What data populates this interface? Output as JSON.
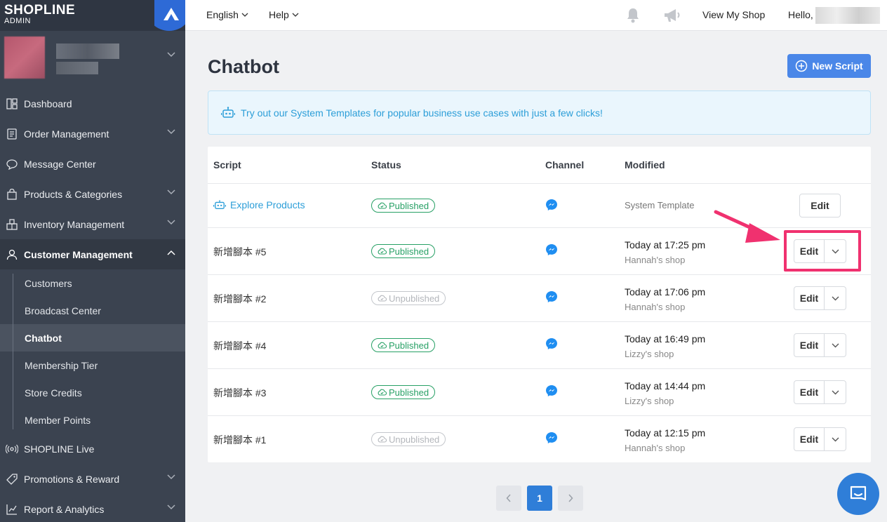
{
  "brand": {
    "name": "SHOPLINE",
    "sub": "ADMIN"
  },
  "sidebar": {
    "items": [
      {
        "label": "Dashboard",
        "icon": "dashboard-icon",
        "chevron": false
      },
      {
        "label": "Order Management",
        "icon": "order-icon",
        "chevron": true
      },
      {
        "label": "Message Center",
        "icon": "chat-icon",
        "chevron": false
      },
      {
        "label": "Products & Categories",
        "icon": "bag-icon",
        "chevron": true
      },
      {
        "label": "Inventory Management",
        "icon": "inventory-icon",
        "chevron": true
      },
      {
        "label": "Customer Management",
        "icon": "user-icon",
        "chevron": true,
        "active": true
      }
    ],
    "sub_items": [
      "Customers",
      "Broadcast Center",
      "Chatbot",
      "Membership Tier",
      "Store Credits",
      "Member Points"
    ],
    "active_sub": "Chatbot",
    "bottom_items": [
      {
        "label": "SHOPLINE Live",
        "icon": "live-icon",
        "chevron": false
      },
      {
        "label": "Promotions & Reward",
        "icon": "tag-icon",
        "chevron": true
      },
      {
        "label": "Report & Analytics",
        "icon": "chart-icon",
        "chevron": true
      }
    ]
  },
  "topbar": {
    "language": "English",
    "help": "Help",
    "view_shop": "View My Shop",
    "hello": "Hello,"
  },
  "page": {
    "title": "Chatbot",
    "new_button": "New Script",
    "banner": "Try out our System Templates for popular business use cases with just a few clicks!"
  },
  "table": {
    "headers": {
      "script": "Script",
      "status": "Status",
      "channel": "Channel",
      "modified": "Modified"
    },
    "rows": [
      {
        "name": "Explore Products",
        "template": true,
        "status": "Published",
        "modified": "System Template",
        "edit": "Edit"
      },
      {
        "name": "新增腳本 #5",
        "status": "Published",
        "time": "Today at 17:25 pm",
        "shop": "Hannah's shop",
        "edit": "Edit"
      },
      {
        "name": "新增腳本 #2",
        "status": "Unpublished",
        "time": "Today at 17:06 pm",
        "shop": "Hannah's shop",
        "edit": "Edit"
      },
      {
        "name": "新增腳本 #4",
        "status": "Published",
        "time": "Today at 16:49 pm",
        "shop": "Lizzy's shop",
        "edit": "Edit"
      },
      {
        "name": "新增腳本 #3",
        "status": "Published",
        "time": "Today at 14:44 pm",
        "shop": "Lizzy's shop",
        "edit": "Edit"
      },
      {
        "name": "新增腳本 #1",
        "status": "Unpublished",
        "time": "Today at 12:15 pm",
        "shop": "Hannah's shop",
        "edit": "Edit"
      }
    ]
  },
  "pagination": {
    "current": "1"
  },
  "colors": {
    "accent": "#4a87e8",
    "published": "#27a065",
    "highlight": "#f0316f",
    "sidebar": "#3b4350"
  }
}
